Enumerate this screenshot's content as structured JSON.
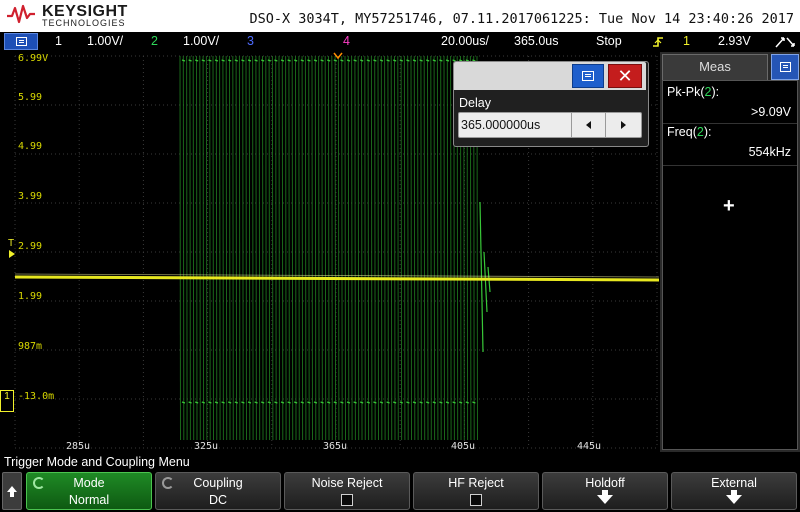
{
  "header": {
    "brand": "KEYSIGHT",
    "brand_sub": "TECHNOLOGIES",
    "title": "DSO-X 3034T, MY57251746, 07.11.2017061225: Tue Nov 14 23:40:26 2017"
  },
  "status_bar": {
    "ch1_num": "1",
    "ch1_scale": "1.00V/",
    "ch2_num": "2",
    "ch2_scale": "1.00V/",
    "ch3_num": "3",
    "ch4_num": "4",
    "timebase": "20.00us/",
    "delay": "365.0us",
    "run_state": "Stop",
    "trigger_source": "1",
    "trigger_level": "2.93V",
    "colors": {
      "ch1": "#f1f12a",
      "ch2": "#2fd85a",
      "ch3": "#4e6bff",
      "ch4": "#ff3ec8"
    }
  },
  "screen": {
    "y_labels": [
      "6.99V",
      "5.99",
      "4.99",
      "3.99",
      "2.99",
      "1.99",
      "987m",
      "-13.0m"
    ],
    "x_labels": [
      "285u",
      "325u",
      "365u",
      "405u",
      "445u"
    ],
    "trigger_marker": "T",
    "ground_marker": "1"
  },
  "delay_dialog": {
    "label": "Delay",
    "value": "365.000000us",
    "close_symbol": "✕",
    "left_arrow": "left-arrow-icon",
    "right_arrow": "right-arrow-icon"
  },
  "measurements": {
    "tab_label": "Meas",
    "items": [
      {
        "name_pre": "Pk-Pk(",
        "channel": "2",
        "name_post": "):",
        "value": ">9.09V"
      },
      {
        "name_pre": "Freq(",
        "channel": "2",
        "name_post": "):",
        "value": "554kHz"
      }
    ],
    "add_symbol": "+"
  },
  "menu": {
    "title": "Trigger Mode and Coupling Menu",
    "softkeys": [
      {
        "label": "Mode",
        "value": "Normal",
        "active": true
      },
      {
        "label": "Coupling",
        "value": "DC"
      },
      {
        "label": "Noise Reject",
        "value": ""
      },
      {
        "label": "HF Reject",
        "value": ""
      },
      {
        "label": "Holdoff",
        "value": ""
      },
      {
        "label": "External",
        "value": ""
      }
    ]
  }
}
